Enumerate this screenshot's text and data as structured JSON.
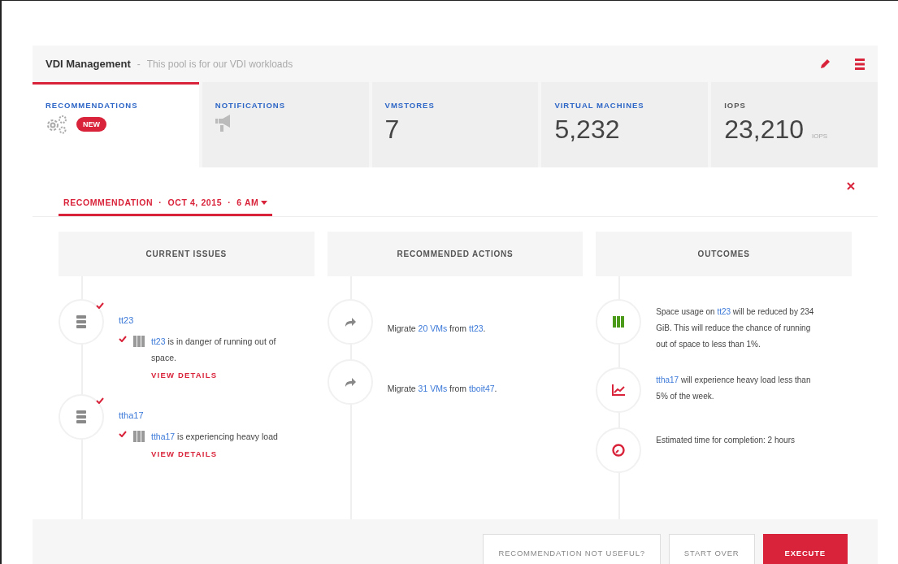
{
  "header": {
    "title": "VDI Management",
    "separator": "-",
    "description": "This pool is for our VDI workloads"
  },
  "tabs": [
    {
      "label": "RECOMMENDATIONS",
      "kind": "recommendations",
      "badge": "NEW",
      "selected": true
    },
    {
      "label": "NOTIFICATIONS",
      "kind": "notifications",
      "selected": false
    },
    {
      "label": "VMSTORES",
      "kind": "value",
      "value": "7",
      "selected": false
    },
    {
      "label": "VIRTUAL MACHINES",
      "kind": "value",
      "value": "5,232",
      "selected": false
    },
    {
      "label": "IOPS",
      "kind": "value",
      "value": "23,210",
      "unit": "IOPS",
      "selected": false
    }
  ],
  "recommendation": {
    "label": "RECOMMENDATION  ·  OCT 4, 2015  ·  6 AM"
  },
  "issues": {
    "title": "CURRENT ISSUES",
    "items": [
      {
        "name": "tt23",
        "checked": true,
        "detail": {
          "checked": true,
          "segments": [
            {
              "text": "tt23",
              "link": true
            },
            {
              "text": " is in danger of running out of space."
            }
          ]
        },
        "action": "VIEW DETAILS"
      },
      {
        "name": "ttha17",
        "checked": true,
        "detail": {
          "checked": true,
          "segments": [
            {
              "text": "ttha17",
              "link": true
            },
            {
              "text": " is experiencing heavy load"
            }
          ]
        },
        "action": "VIEW DETAILS"
      }
    ]
  },
  "actions": {
    "title": "RECOMMENDED ACTIONS",
    "items": [
      {
        "segments": [
          {
            "text": "Migrate "
          },
          {
            "text": "20 VMs",
            "link": true
          },
          {
            "text": " from "
          },
          {
            "text": "tt23",
            "link": true
          },
          {
            "text": "."
          }
        ]
      },
      {
        "segments": [
          {
            "text": "Migrate "
          },
          {
            "text": "31 VMs",
            "link": true
          },
          {
            "text": " from "
          },
          {
            "text": "tboit47",
            "link": true
          },
          {
            "text": "."
          }
        ]
      }
    ]
  },
  "outcomes": {
    "title": "OUTCOMES",
    "items": [
      {
        "kind": "storage",
        "segments": [
          {
            "text": "Space usage on "
          },
          {
            "text": "tt23",
            "link": true
          },
          {
            "text": " will be reduced by 234 GiB. This will reduce the chance of running out of space to less than 1%."
          }
        ]
      },
      {
        "kind": "chart",
        "segments": [
          {
            "text": "ttha17",
            "link": true
          },
          {
            "text": " will experience heavy load less than 5% of the week."
          }
        ]
      },
      {
        "kind": "clock",
        "segments": [
          {
            "text": "Estimated time for completion: 2 hours"
          }
        ]
      }
    ]
  },
  "buttons": [
    {
      "label": "RECOMMENDATION NOT USEFUL?",
      "kind": "secondary"
    },
    {
      "label": "START OVER",
      "kind": "secondary"
    },
    {
      "label": "EXECUTE",
      "kind": "primary"
    }
  ]
}
